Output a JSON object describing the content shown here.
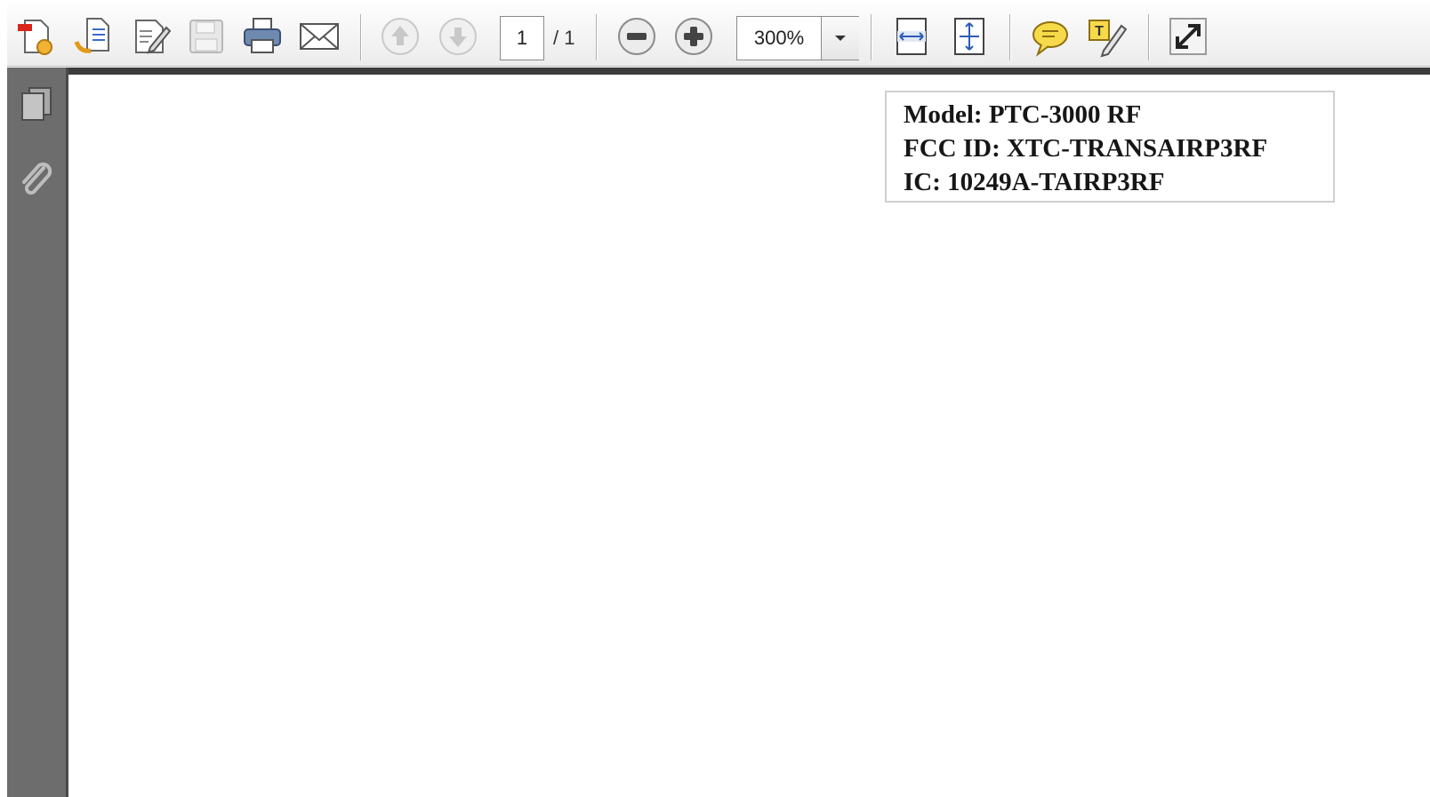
{
  "toolbar": {
    "page_current": "1",
    "page_total": "/ 1",
    "zoom": "300%",
    "icons": [
      "create-pdf-icon",
      "combine-files-icon",
      "edit-icon",
      "save-icon",
      "print-icon",
      "email-icon",
      "previous-page-icon",
      "next-page-icon",
      "zoom-out-icon",
      "zoom-in-icon",
      "fit-width-icon",
      "fit-page-icon",
      "comment-icon",
      "sign-icon",
      "full-screen-icon"
    ]
  },
  "sidebar": {
    "icons": [
      "pages-icon",
      "attachments-icon"
    ]
  },
  "document": {
    "lines": [
      "Model: PTC-3000 RF",
      "FCC ID: XTC-TRANSAIRP3RF",
      "IC: 10249A-TAIRP3RF"
    ]
  },
  "colors": {
    "sidebar": "#6d6d6d",
    "toolbar": "#ececec",
    "accent_yellow": "#f5d33a"
  }
}
